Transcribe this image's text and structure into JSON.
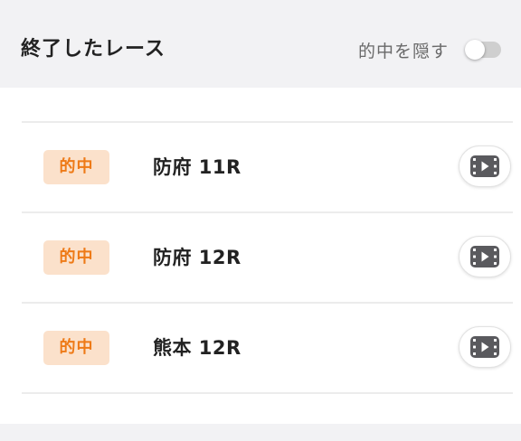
{
  "header": {
    "title": "終了したレース",
    "hide_hits_label": "的中を隠す",
    "hide_hits_toggle": "off"
  },
  "races": [
    {
      "badge": "的中",
      "name": "防府 11R",
      "action_icon": "video-play-icon"
    },
    {
      "badge": "的中",
      "name": "防府 12R",
      "action_icon": "video-play-icon"
    },
    {
      "badge": "的中",
      "name": "熊本 12R",
      "action_icon": "video-play-icon"
    }
  ],
  "colors": {
    "header_bg": "#f2f2f4",
    "badge_bg": "#fbe1cb",
    "badge_text": "#ee7a17",
    "icon": "#5a5a5e"
  }
}
